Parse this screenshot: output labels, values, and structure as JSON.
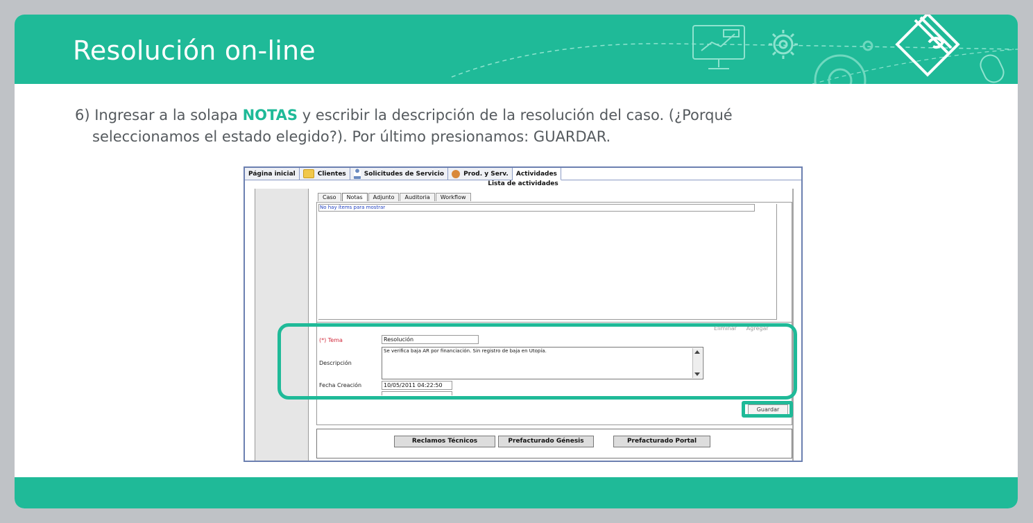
{
  "slide": {
    "title": "Resolución on-line",
    "instruction": {
      "prefix": "6) Ingresar a la solapa ",
      "keyword": "NOTAS",
      "line1_rest": " y escribir la descripción de la resolución del caso. (¿Porqué",
      "line2": "seleccionamos el estado elegido?). Por último presionamos: GUARDAR."
    },
    "accent_color": "#1fba98"
  },
  "app": {
    "nav_tabs": [
      {
        "label": "Página inicial",
        "icon": ""
      },
      {
        "label": "Clientes",
        "icon": "folder-icon"
      },
      {
        "label": "Solicitudes de Servicio",
        "icon": "person-icon"
      },
      {
        "label": "Prod. y Serv.",
        "icon": "gears-icon"
      },
      {
        "label": "Actividades",
        "icon": ""
      }
    ],
    "active_nav": "Actividades",
    "caption": "Lista de actividades",
    "sub_tabs": [
      "Caso",
      "Notas",
      "Adjunto",
      "Auditoria",
      "Workflow"
    ],
    "active_sub_tab": "Notas",
    "empty_list_text": "No hay ítems para mostrar",
    "list_actions": [
      "Eliminar",
      "Agregar"
    ],
    "form": {
      "tema_label": "(*) Tema",
      "tema_value": "Resolución",
      "descripcion_label": "Descripción",
      "descripcion_value": "Se verifica baja AR por financiación. Sin registro de baja en Utopía.",
      "fecha_label": "Fecha Creación",
      "fecha_value": "10/05/2011 04:22:50"
    },
    "save_button": "Guardar",
    "bottom_buttons": [
      "Reclamos Técnicos",
      "Prefacturado Génesis",
      "Prefacturado Portal"
    ]
  }
}
